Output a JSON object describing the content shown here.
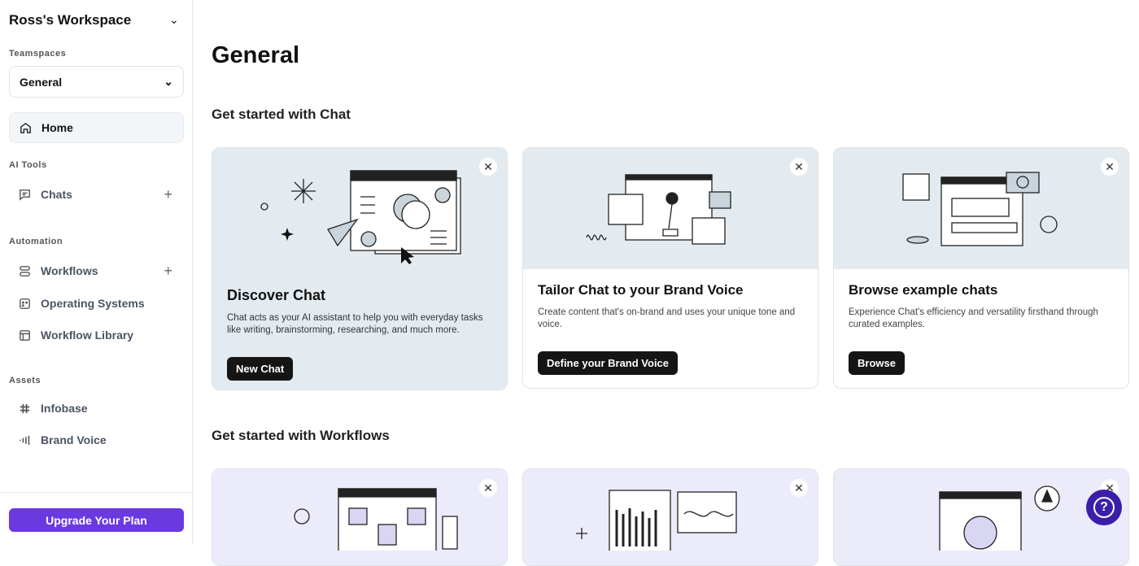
{
  "sidebar": {
    "workspace": "Ross's Workspace",
    "teamspaces_label": "Teamspaces",
    "teamspace": "General",
    "home": "Home",
    "ai_tools_label": "AI Tools",
    "chats": "Chats",
    "automation_label": "Automation",
    "workflows": "Workflows",
    "operating_systems": "Operating Systems",
    "workflow_library": "Workflow Library",
    "assets_label": "Assets",
    "infobase": "Infobase",
    "brand_voice": "Brand Voice",
    "upgrade": "Upgrade Your Plan"
  },
  "main": {
    "title": "General",
    "chat_section": "Get started with Chat",
    "workflows_section": "Get started with Workflows",
    "cards": [
      {
        "title": "Discover Chat",
        "desc": "Chat acts as your AI assistant to help you with everyday tasks like writing, brainstorming, researching, and much more.",
        "button": "New Chat"
      },
      {
        "title": "Tailor Chat to your Brand Voice",
        "desc": "Create content that's on-brand and uses your unique tone and voice.",
        "button": "Define your Brand Voice"
      },
      {
        "title": "Browse example chats",
        "desc": "Experience Chat's efficiency and versatility firsthand through curated examples.",
        "button": "Browse"
      }
    ]
  },
  "help": "?",
  "colors": {
    "accent": "#6a3ae0",
    "help": "#3b1fa8",
    "card_bg": "#e4ebf0",
    "workflow_bg": "#ecebfa"
  }
}
